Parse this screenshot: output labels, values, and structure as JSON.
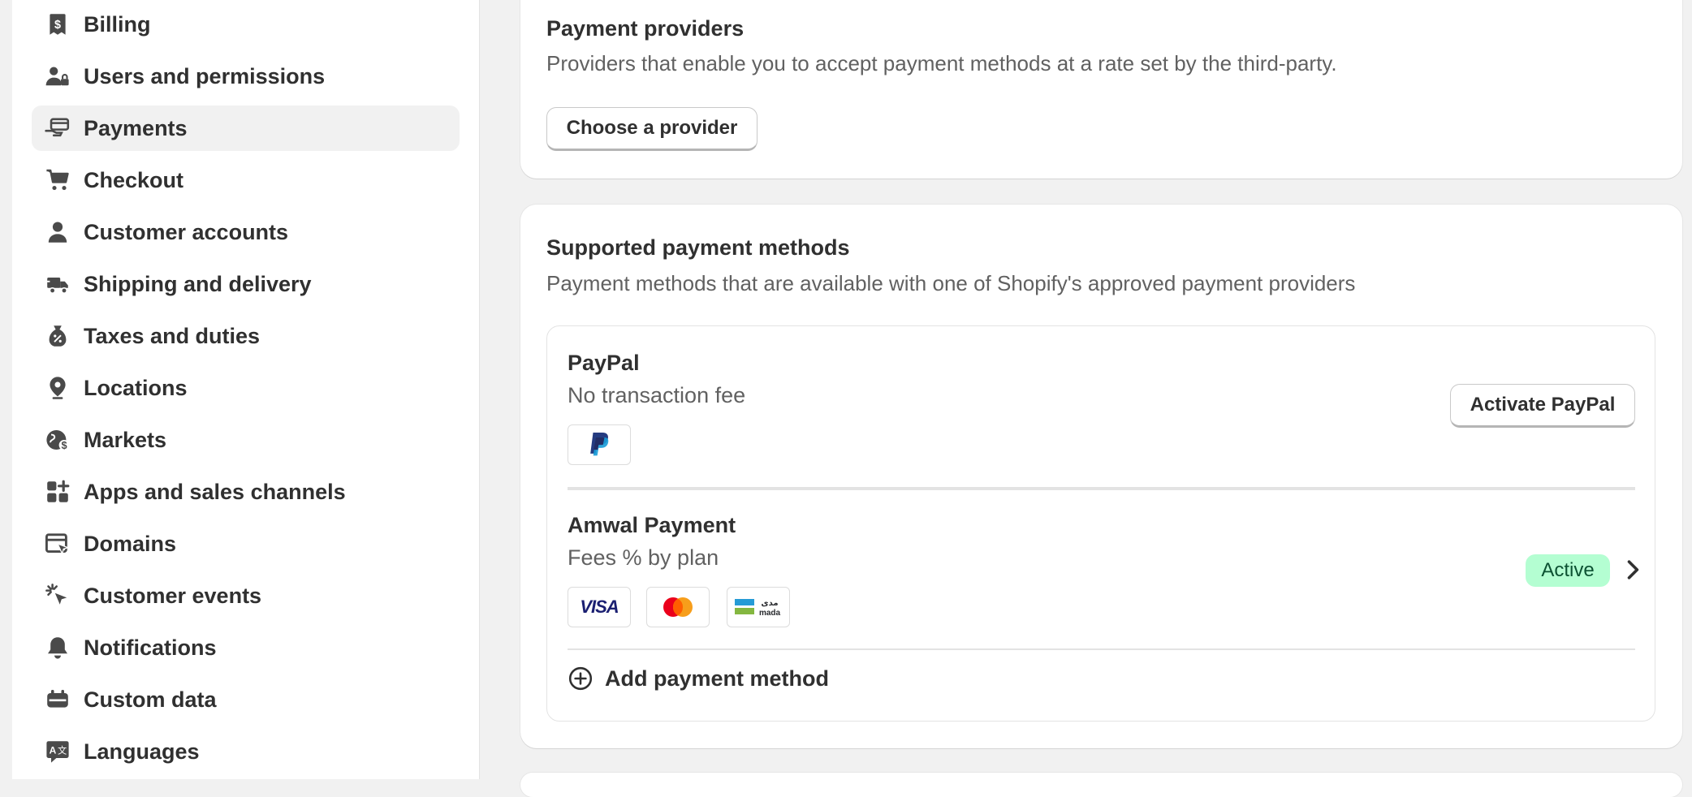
{
  "sidebar": {
    "items": [
      {
        "label": "Billing",
        "icon": "billing-icon",
        "active": false
      },
      {
        "label": "Users and permissions",
        "icon": "users-icon",
        "active": false
      },
      {
        "label": "Payments",
        "icon": "payments-icon",
        "active": true
      },
      {
        "label": "Checkout",
        "icon": "cart-icon",
        "active": false
      },
      {
        "label": "Customer accounts",
        "icon": "person-icon",
        "active": false
      },
      {
        "label": "Shipping and delivery",
        "icon": "truck-icon",
        "active": false
      },
      {
        "label": "Taxes and duties",
        "icon": "tax-icon",
        "active": false
      },
      {
        "label": "Locations",
        "icon": "location-pin-icon",
        "active": false
      },
      {
        "label": "Markets",
        "icon": "globe-icon",
        "active": false
      },
      {
        "label": "Apps and sales channels",
        "icon": "apps-icon",
        "active": false
      },
      {
        "label": "Domains",
        "icon": "domains-icon",
        "active": false
      },
      {
        "label": "Customer events",
        "icon": "cursor-click-icon",
        "active": false
      },
      {
        "label": "Notifications",
        "icon": "bell-icon",
        "active": false
      },
      {
        "label": "Custom data",
        "icon": "custom-data-icon",
        "active": false
      },
      {
        "label": "Languages",
        "icon": "language-icon",
        "active": false
      }
    ]
  },
  "providers": {
    "title": "Payment providers",
    "description": "Providers that enable you to accept payment methods at a rate set by the third-party.",
    "choose_button": "Choose a provider"
  },
  "supported": {
    "title": "Supported payment methods",
    "description": "Payment methods that are available with one of Shopify's approved payment providers",
    "methods": [
      {
        "name": "PayPal",
        "fee": "No transaction fee",
        "action": "Activate PayPal",
        "logos": [
          "paypal-logo"
        ]
      },
      {
        "name": "Amwal Payment",
        "fee": "Fees % by plan",
        "status": "Active",
        "logos": [
          "visa-logo",
          "mastercard-logo",
          "mada-logo"
        ]
      }
    ],
    "add_label": "Add payment method"
  },
  "logo_text": {
    "visa": "VISA",
    "mada_top": "مدى",
    "mada_bottom": "mada"
  },
  "colors": {
    "active_bg": "#b4fed2",
    "active_text": "#0c5132",
    "nav_active_bg": "#f1f1f1"
  }
}
